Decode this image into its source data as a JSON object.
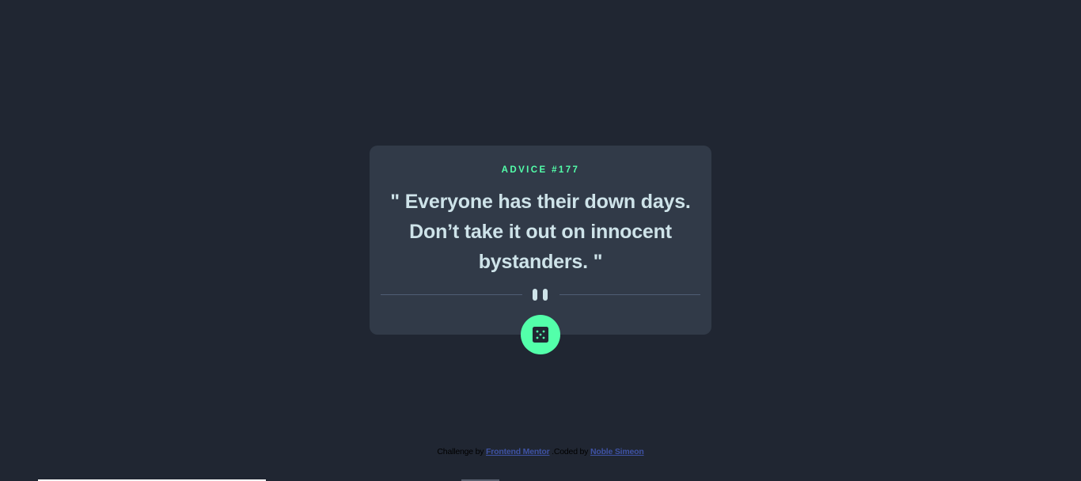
{
  "card": {
    "advice_id": "ADVICE #177",
    "quote": "\" Everyone has their down days. Don’t take it out on innocent bystanders. \""
  },
  "buttons": {
    "generate_icon": "dice-icon"
  },
  "footer": {
    "challenge_prefix": "Challenge by",
    "challenge_link": "Frontend Mentor",
    "coded_prefix": ".Coded by",
    "coded_link": "Noble Simeon"
  },
  "colors": {
    "background": "#202632",
    "card": "#313A48",
    "accent": "#53FFAA",
    "text": "#CEE3E9",
    "divider": "#4F5D74",
    "link": "#3E52A3"
  }
}
